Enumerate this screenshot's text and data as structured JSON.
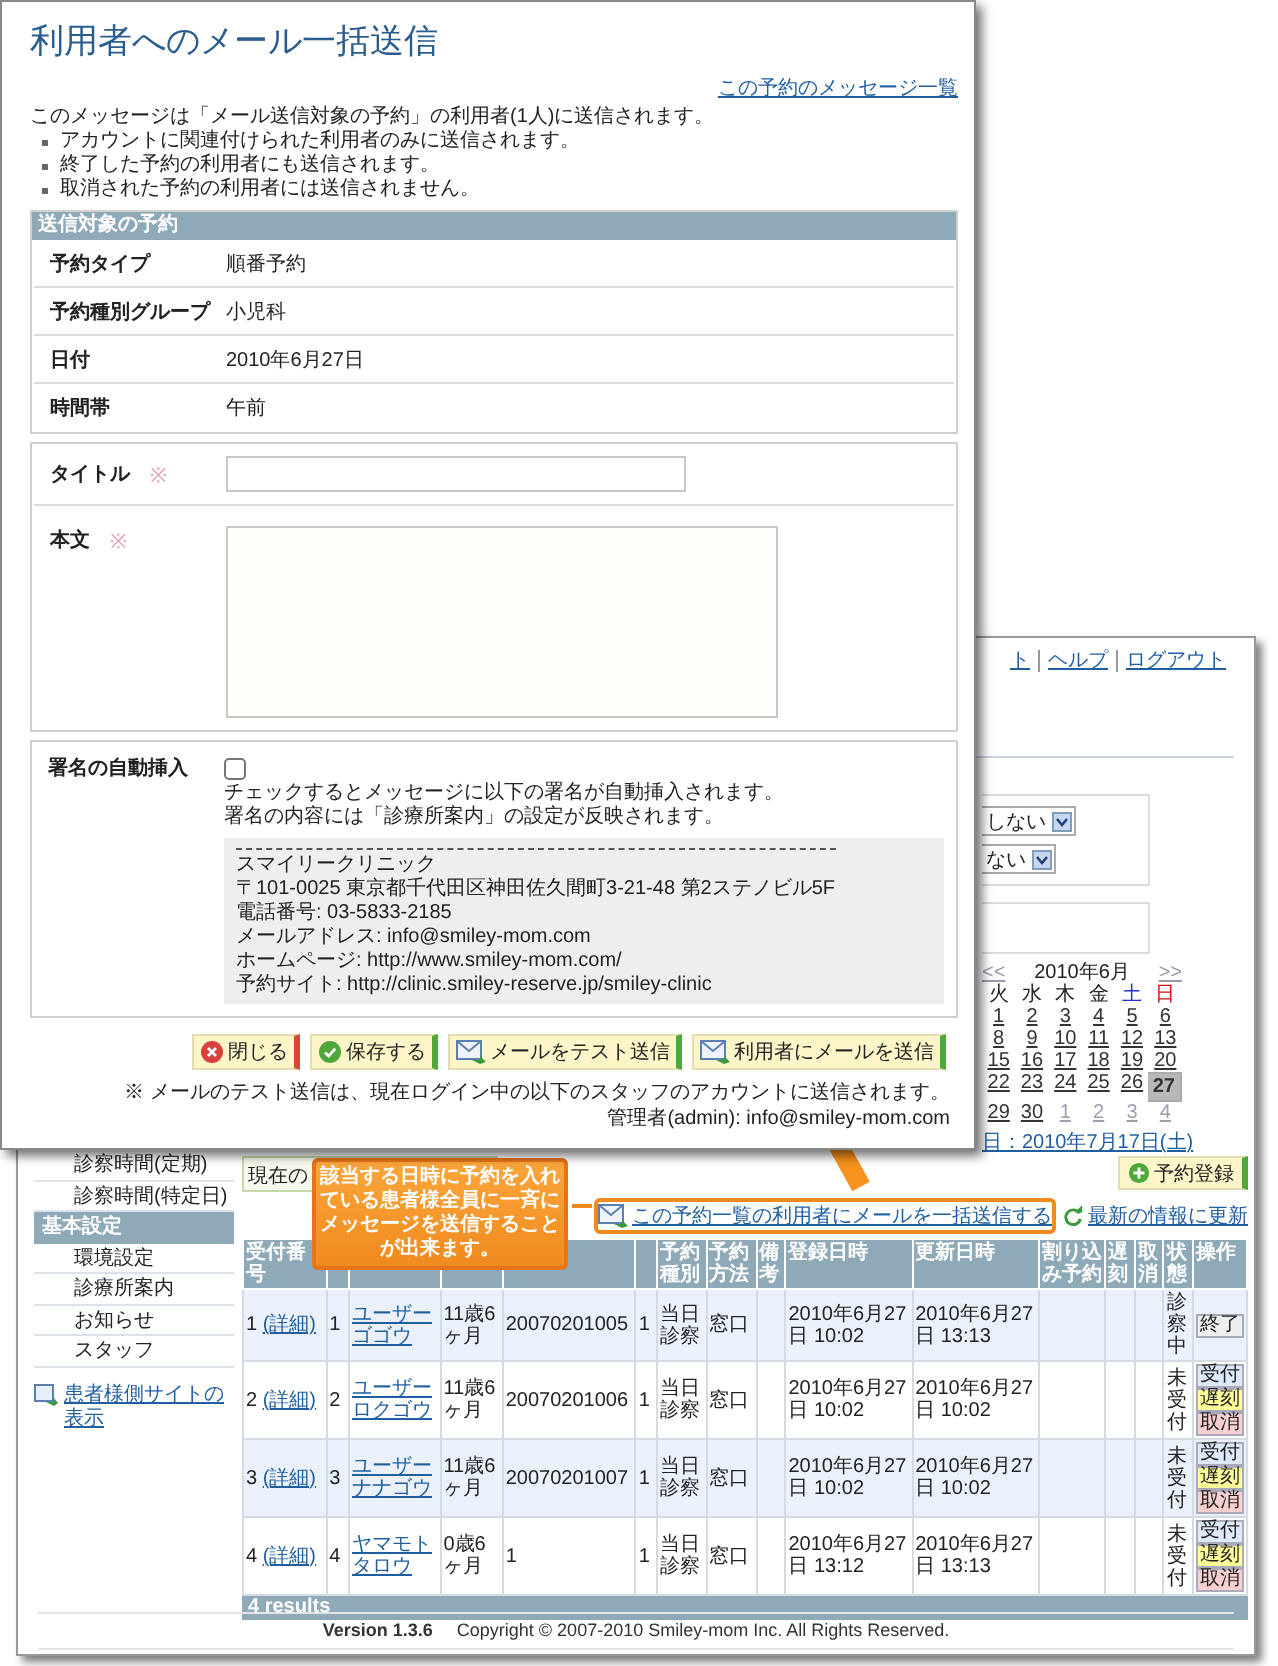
{
  "dialog": {
    "title": "利用者へのメール一括送信",
    "messages_link": "この予約のメッセージ一覧",
    "intro": "このメッセージは「メール送信対象の予約」の利用者(1人)に送信されます。",
    "notes": [
      "アカウントに関連付けられた利用者のみに送信されます。",
      "終了した予約の利用者にも送信されます。",
      "取消された予約の利用者には送信されません。"
    ],
    "target": {
      "title": "送信対象の予約",
      "fields": [
        {
          "label": "予約タイプ",
          "value": "順番予約"
        },
        {
          "label": "予約種別グループ",
          "value": "小児科"
        },
        {
          "label": "日付",
          "value": "2010年6月27日"
        },
        {
          "label": "時間帯",
          "value": "午前"
        }
      ]
    },
    "form": [
      {
        "label": "タイトル",
        "required_mark": "※",
        "kind": "input"
      },
      {
        "label": "本文",
        "required_mark": "※",
        "kind": "textarea"
      }
    ],
    "signature": {
      "label": "署名の自動挿入",
      "checked": false,
      "help": [
        "チェックするとメッセージに以下の署名が自動挿入されます。",
        "署名の内容には「診療所案内」の設定が反映されます。"
      ],
      "lines": [
        "スマイリークリニック",
        "〒101-0025 東京都千代田区神田佐久間町3-21-48 第2ステノビル5F",
        "電話番号: 03-5833-2185",
        "メールアドレス: info@smiley-mom.com",
        "ホームページ: http://www.smiley-mom.com/",
        "予約サイト: http://clinic.smiley-reserve.jp/smiley-clinic"
      ]
    },
    "buttons": [
      {
        "label": "閉じる",
        "kind": "close"
      },
      {
        "label": "保存する",
        "kind": "save"
      },
      {
        "label": "メールをテスト送信",
        "kind": "test"
      },
      {
        "label": "利用者にメールを送信",
        "kind": "send"
      }
    ],
    "test_note": "※ メールのテスト送信は、現在ログイン中の以下のスタッフのアカウントに送信されます。",
    "admin_line": "管理者(admin): info@smiley-mom.com"
  },
  "background": {
    "nav_links": [
      "ト",
      "ヘルプ",
      "ログアウト"
    ],
    "filters": [
      {
        "value": "しない"
      },
      {
        "value": "ない"
      }
    ],
    "calendar": {
      "prev": "<<",
      "month": "2010年6月",
      "next": ">>",
      "weekdays": [
        {
          "label": "火",
          "kind": "weekday"
        },
        {
          "label": "水",
          "kind": "weekday"
        },
        {
          "label": "木",
          "kind": "weekday"
        },
        {
          "label": "金",
          "kind": "weekday"
        },
        {
          "label": "土",
          "kind": "saturday"
        },
        {
          "label": "日",
          "kind": "sunday"
        }
      ],
      "weeks": [
        [
          {
            "day": "1",
            "kind": "current",
            "selected": false
          },
          {
            "day": "2",
            "kind": "current",
            "selected": false
          },
          {
            "day": "3",
            "kind": "current",
            "selected": false
          },
          {
            "day": "4",
            "kind": "current",
            "selected": false
          },
          {
            "day": "5",
            "kind": "current",
            "selected": false
          },
          {
            "day": "6",
            "kind": "current",
            "selected": false
          }
        ],
        [
          {
            "day": "8",
            "kind": "current",
            "selected": false
          },
          {
            "day": "9",
            "kind": "current",
            "selected": false
          },
          {
            "day": "10",
            "kind": "current",
            "selected": false
          },
          {
            "day": "11",
            "kind": "current",
            "selected": false
          },
          {
            "day": "12",
            "kind": "current",
            "selected": false
          },
          {
            "day": "13",
            "kind": "current",
            "selected": false
          }
        ],
        [
          {
            "day": "15",
            "kind": "current",
            "selected": false
          },
          {
            "day": "16",
            "kind": "current",
            "selected": false
          },
          {
            "day": "17",
            "kind": "current",
            "selected": false
          },
          {
            "day": "18",
            "kind": "current",
            "selected": false
          },
          {
            "day": "19",
            "kind": "current",
            "selected": false
          },
          {
            "day": "20",
            "kind": "current",
            "selected": false
          }
        ],
        [
          {
            "day": "22",
            "kind": "current",
            "selected": false
          },
          {
            "day": "23",
            "kind": "current",
            "selected": false
          },
          {
            "day": "24",
            "kind": "current",
            "selected": false
          },
          {
            "day": "25",
            "kind": "current",
            "selected": false
          },
          {
            "day": "26",
            "kind": "current",
            "selected": false
          },
          {
            "day": "27",
            "kind": "current",
            "selected": true
          }
        ],
        [
          {
            "day": "29",
            "kind": "current",
            "selected": false
          },
          {
            "day": "30",
            "kind": "current",
            "selected": false
          },
          {
            "day": "1",
            "kind": "other",
            "selected": false
          },
          {
            "day": "2",
            "kind": "other",
            "selected": false
          },
          {
            "day": "3",
            "kind": "other",
            "selected": false
          },
          {
            "day": "4",
            "kind": "other",
            "selected": false
          }
        ]
      ]
    },
    "next_date_link": "日：2010年7月17日(土)",
    "sidebar": [
      {
        "label": "診察時間(定期)",
        "kind": "item"
      },
      {
        "label": "診察時間(特定日)",
        "kind": "item"
      },
      {
        "label": "基本設定",
        "kind": "header"
      },
      {
        "label": "環境設定",
        "kind": "item"
      },
      {
        "label": "診療所案内",
        "kind": "item"
      },
      {
        "label": "お知らせ",
        "kind": "item"
      },
      {
        "label": "スタッフ",
        "kind": "item"
      },
      {
        "label": "患者様側サイトの表示",
        "kind": "link"
      }
    ],
    "main": {
      "current_label": "現在の",
      "register_button": "予約登録",
      "bulk_link": {
        "label": "この予約一覧の利用者にメールを一括送信する",
        "highlighted": true
      },
      "refresh_link": "最新の情報に更新",
      "columns": [
        {
          "label": "受付番号"
        },
        {},
        {},
        {},
        {},
        {},
        {
          "label": "予約種別"
        },
        {
          "label": "予約方法"
        },
        {
          "label": "備考"
        },
        {
          "label": "登録日時"
        },
        {
          "label": "更新日時"
        },
        {
          "label": "割り込み予約"
        },
        {
          "label": "遅刻"
        },
        {
          "label": "取消"
        },
        {
          "label": "状態"
        },
        {
          "label": "操作"
        }
      ],
      "rows": [
        {
          "number": "1",
          "detail_link": "(詳細)",
          "order": "1",
          "name": "ユーザーゴゴウ",
          "age": "11歳6ヶ月",
          "patient_id": "20070201005",
          "count": "1",
          "type": "当日診察",
          "method": "窓口",
          "registered": "2010年6月27日 10:02",
          "updated": "2010年6月27日 13:13",
          "status": "診察中",
          "actions": [
            {
              "label": "終了",
              "kind": "finish"
            }
          ]
        },
        {
          "number": "2",
          "detail_link": "(詳細)",
          "order": "2",
          "name": "ユーザーロクゴウ",
          "age": "11歳6ヶ月",
          "patient_id": "20070201006",
          "count": "1",
          "type": "当日診察",
          "method": "窓口",
          "registered": "2010年6月27日 10:02",
          "updated": "2010年6月27日 10:02",
          "status": "未受付",
          "actions": [
            {
              "label": "受付",
              "kind": "accept"
            },
            {
              "label": "遅刻",
              "kind": "late"
            },
            {
              "label": "取消",
              "kind": "cancel"
            }
          ]
        },
        {
          "number": "3",
          "detail_link": "(詳細)",
          "order": "3",
          "name": "ユーザーナナゴウ",
          "age": "11歳6ヶ月",
          "patient_id": "20070201007",
          "count": "1",
          "type": "当日診察",
          "method": "窓口",
          "registered": "2010年6月27日 10:02",
          "updated": "2010年6月27日 10:02",
          "status": "未受付",
          "actions": [
            {
              "label": "受付",
              "kind": "accept"
            },
            {
              "label": "遅刻",
              "kind": "late"
            },
            {
              "label": "取消",
              "kind": "cancel"
            }
          ]
        },
        {
          "number": "4",
          "detail_link": "(詳細)",
          "order": "4",
          "name": "ヤマモトタロウ",
          "age": "0歳6ヶ月",
          "patient_id": "1",
          "count": "1",
          "type": "当日診察",
          "method": "窓口",
          "registered": "2010年6月27日 13:12",
          "updated": "2010年6月27日 13:13",
          "status": "未受付",
          "actions": [
            {
              "label": "受付",
              "kind": "accept"
            },
            {
              "label": "遅刻",
              "kind": "late"
            },
            {
              "label": "取消",
              "kind": "cancel"
            }
          ]
        }
      ],
      "results": "4 results"
    },
    "footer": {
      "version": "Version 1.3.6",
      "copyright": "Copyright © 2007-2010 Smiley-mom Inc. All Rights Reserved."
    }
  },
  "callout": {
    "text": "該当する日時に予約を入れている患者様全員に一斉にメッセージを送信することが出来ます。"
  }
}
